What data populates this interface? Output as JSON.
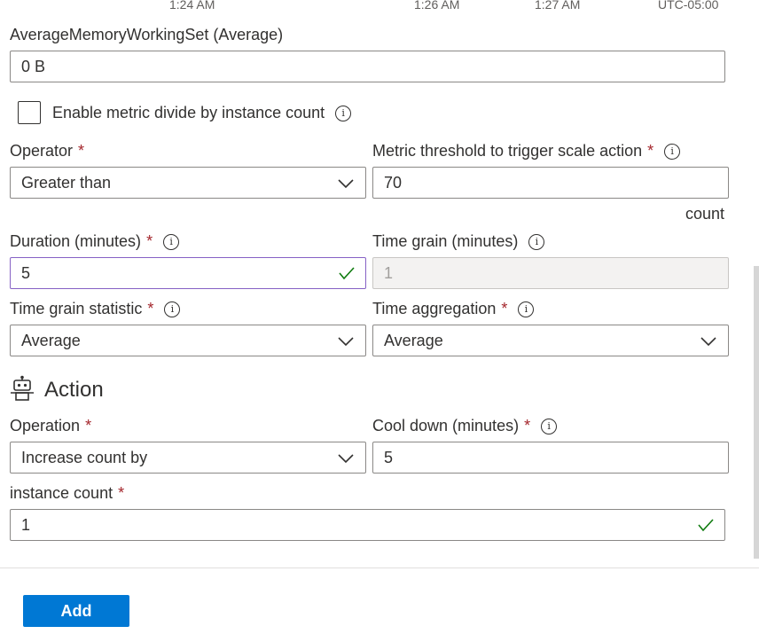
{
  "chart_axis": {
    "ticks": [
      "1:24 AM",
      "1:26 AM",
      "1:27 AM"
    ],
    "timezone": "UTC-05:00"
  },
  "metric": {
    "label": "AverageMemoryWorkingSet (Average)",
    "value": "0 B"
  },
  "divide_by_instance": {
    "label": "Enable metric divide by instance count",
    "checked": false
  },
  "operator": {
    "label": "Operator",
    "required": "*",
    "value": "Greater than"
  },
  "threshold": {
    "label": "Metric threshold to trigger scale action",
    "required": "*",
    "value": "70",
    "unit": "count"
  },
  "duration": {
    "label": "Duration (minutes)",
    "required": "*",
    "value": "5"
  },
  "time_grain": {
    "label": "Time grain (minutes)",
    "value": "1"
  },
  "time_grain_statistic": {
    "label": "Time grain statistic",
    "required": "*",
    "value": "Average"
  },
  "time_aggregation": {
    "label": "Time aggregation",
    "required": "*",
    "value": "Average"
  },
  "action": {
    "heading": "Action",
    "icon": "robot-icon"
  },
  "operation": {
    "label": "Operation",
    "required": "*",
    "value": "Increase count by"
  },
  "cool_down": {
    "label": "Cool down (minutes)",
    "required": "*",
    "value": "5"
  },
  "instance_count": {
    "label": "instance count",
    "required": "*",
    "value": "1"
  },
  "footer": {
    "add_label": "Add"
  },
  "colors": {
    "primary": "#0078d4",
    "required": "#a4262c",
    "valid_check": "#107c10",
    "valid_border": "#8661c5"
  }
}
